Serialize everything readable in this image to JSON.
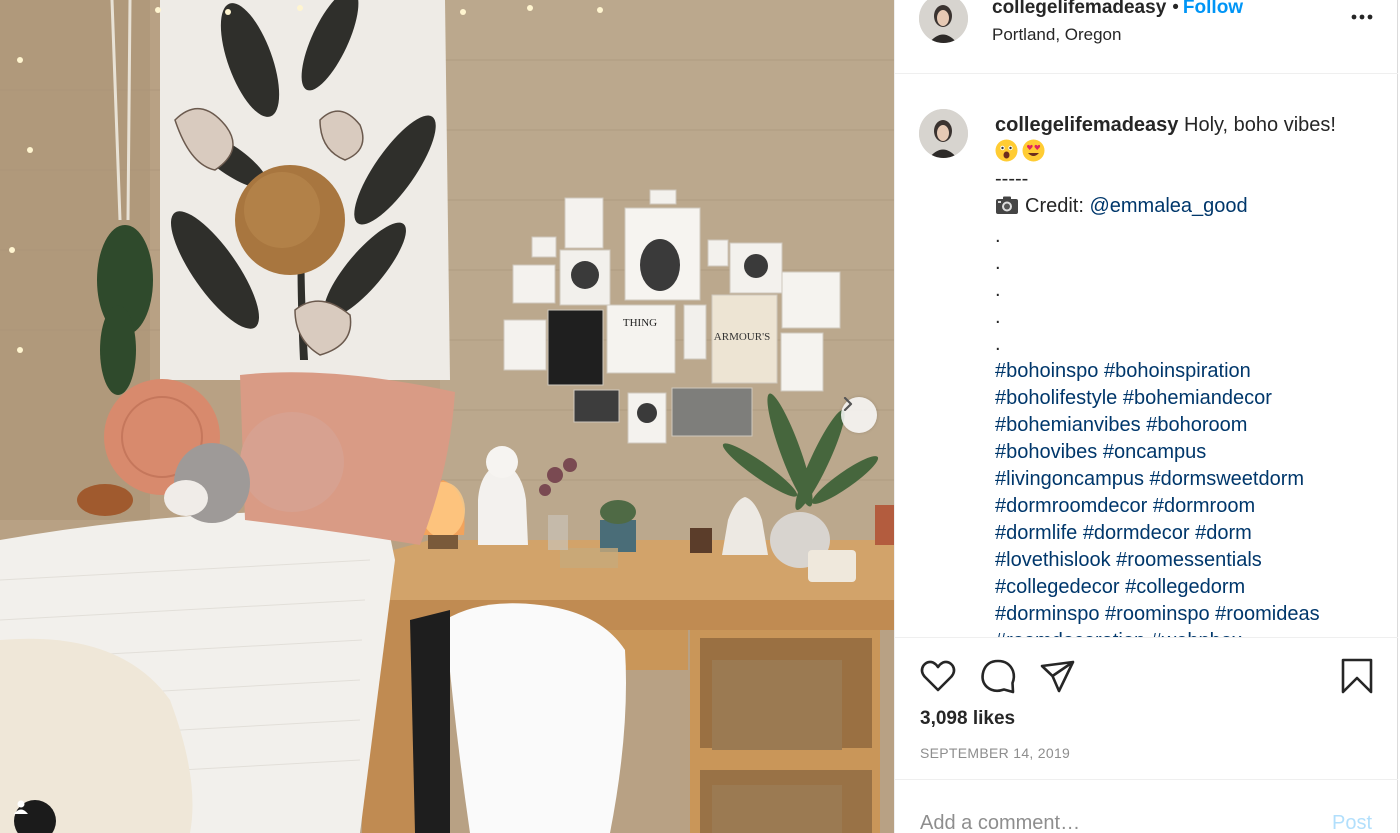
{
  "photo": {
    "alt": "",
    "next_icon": "chevron-right-icon",
    "tag_icon": "user-icon"
  },
  "post": {
    "username": "collegelifemadeasy",
    "separator": "•",
    "follow_label": "Follow",
    "location": "Portland, Oregon",
    "more_icon": "ellipsis-icon"
  },
  "caption": {
    "username": "collegelifemadeasy",
    "text": "Holy, boho vibes!",
    "emojis": [
      "astonished-face-emoji",
      "heart-eyes-emoji"
    ],
    "divider": "-----",
    "credit_label": "Credit:",
    "credit_icon": "camera-icon",
    "credit_handle": "@emmalea_good",
    "dots": [
      ".",
      ".",
      ".",
      ".",
      "."
    ],
    "hashtag_lines": [
      "#bohoinspo #bohoinspiration",
      "#boholifestyle #bohemiandecor",
      "#bohemianvibes #bohoroom",
      "#bohovibes #oncampus",
      "#livingoncampus #dormsweetdorm",
      "#dormroomdecor #dormroom",
      "#dormlife #dormdecor #dorm",
      "#lovethislook #roomessentials",
      "#collegedecor #collegedorm",
      "#dorminspo #roominspo #roomideas",
      "#roomdecoration #wohnbox"
    ]
  },
  "actions": {
    "like_icon": "heart-icon",
    "comment_icon": "comment-icon",
    "share_icon": "paper-plane-icon",
    "save_icon": "bookmark-icon",
    "likes": "3,098 likes",
    "date": "SEPTEMBER 14, 2019"
  },
  "comment_box": {
    "placeholder": "Add a comment…",
    "post_label": "Post"
  },
  "colors": {
    "link_blue": "#0095f6",
    "hashtag_blue": "#00376b",
    "post_disabled": "#b2dffc",
    "muted": "#8e8e8e"
  }
}
